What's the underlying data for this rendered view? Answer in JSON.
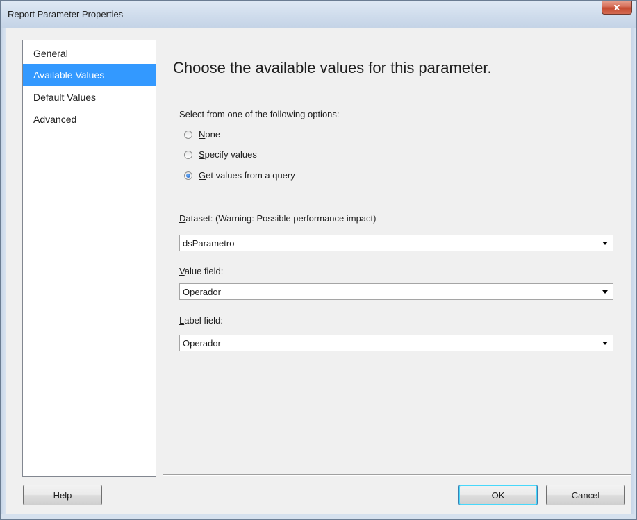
{
  "window": {
    "title": "Report Parameter Properties",
    "close_glyph": "x"
  },
  "sidebar": {
    "items": [
      {
        "label": "General",
        "selected": false
      },
      {
        "label": "Available Values",
        "selected": true
      },
      {
        "label": "Default Values",
        "selected": false
      },
      {
        "label": "Advanced",
        "selected": false
      }
    ]
  },
  "main": {
    "heading": "Choose the available values for this parameter.",
    "options_label": "Select from one of the following options:",
    "options": [
      {
        "accel": "N",
        "rest": "one",
        "checked": false
      },
      {
        "accel": "S",
        "rest": "pecify values",
        "checked": false
      },
      {
        "accel": "G",
        "rest": "et values from a query",
        "checked": true
      }
    ],
    "dataset": {
      "accel": "D",
      "rest": "ataset: (Warning: Possible performance impact)",
      "value": "dsParametro"
    },
    "value_field": {
      "accel": "V",
      "rest": "alue field:",
      "value": "Operador"
    },
    "label_field": {
      "accel": "L",
      "rest": "abel field:",
      "value": "Operador"
    }
  },
  "buttons": {
    "help": "Help",
    "ok": "OK",
    "cancel": "Cancel"
  },
  "colors": {
    "selection": "#3399ff",
    "window_bg": "#f0f0f0",
    "close": "#c44a30"
  }
}
